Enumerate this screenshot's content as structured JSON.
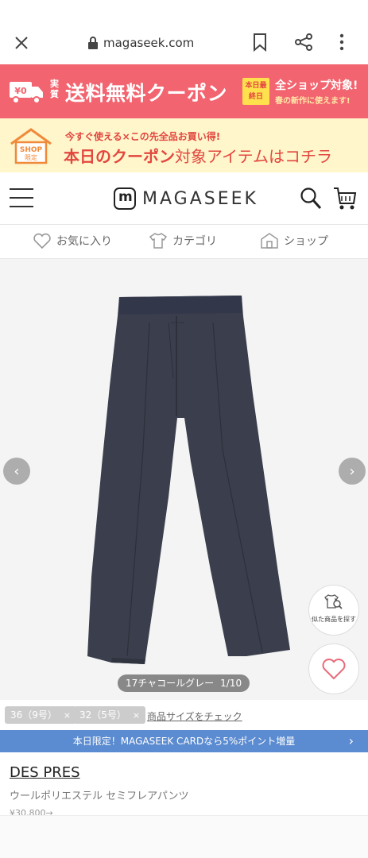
{
  "browser": {
    "url": "magaseek.com"
  },
  "banner1": {
    "badge": "¥0",
    "jitsu": "実質",
    "main": "送料無料クーポン",
    "today": "本日最終日",
    "line1": "全ショップ対象!",
    "line2": "春の新作に使えます!"
  },
  "banner2": {
    "shop_badge": "SHOP限定",
    "line1": "今すぐ使える×この先全品お買い得!",
    "line2_bold": "本日のクーポン",
    "line2_rest": "対象アイテムはコチラ"
  },
  "header": {
    "logo": "MAGASEEK"
  },
  "subnav": {
    "fav": "お気に入り",
    "category": "カテゴリ",
    "shop": "ショップ"
  },
  "gallery": {
    "similar": "似た商品を探す",
    "color": "17チャコールグレー",
    "page": "1/10",
    "product_color": "#3b3f4d"
  },
  "sizes": {
    "chips": [
      "36（9号）",
      "32（5号）"
    ],
    "check_link": "商品サイズをチェック"
  },
  "cardbar": {
    "text": "本日限定！MAGASEEK CARDなら5%ポイント増量"
  },
  "product": {
    "brand": "DES PRES",
    "name": "ウールポリエステル セミフレアパンツ",
    "price": "¥30,800→"
  }
}
